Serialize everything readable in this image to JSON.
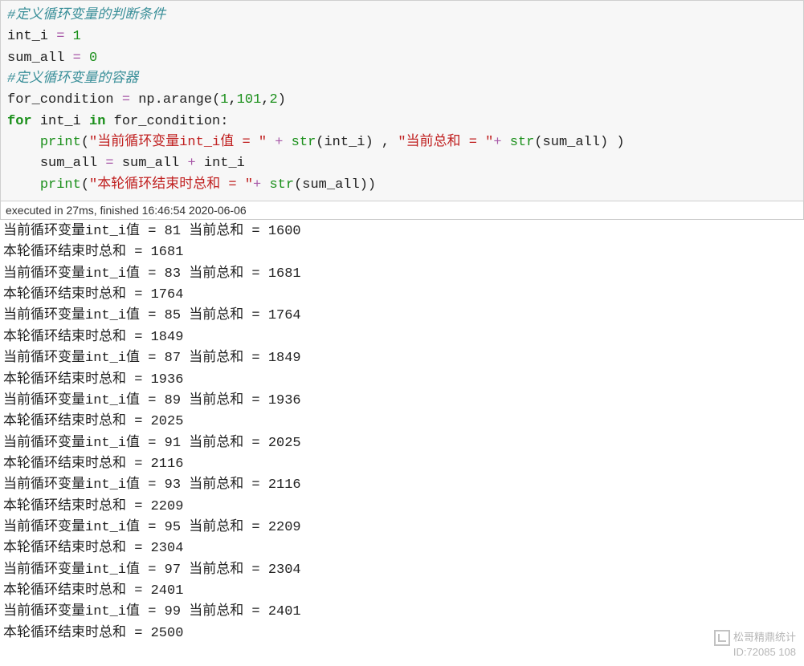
{
  "code": {
    "comment1": "#定义循环变量的判断条件",
    "line2_var": "int_i",
    "line2_eq": " = ",
    "line2_val": "1",
    "line3_var": "sum_all",
    "line3_eq": " = ",
    "line3_val": "0",
    "comment2": "#定义循环变量的容器",
    "line5_var": "for_condition",
    "line5_eq": " = ",
    "line5_np": "np.",
    "line5_fn": "arange",
    "line5_args_open": "(",
    "line5_arg1": "1",
    "line5_comma1": ",",
    "line5_arg2": "101",
    "line5_comma2": ",",
    "line5_arg3": "2",
    "line5_args_close": ")",
    "line6_for": "for",
    "line6_sp1": " ",
    "line6_var": "int_i",
    "line6_sp2": " ",
    "line6_in": "in",
    "line6_sp3": " ",
    "line6_iter": "for_condition",
    "line6_colon": ":",
    "indent": "    ",
    "line7_print": "print",
    "line7_open": "(",
    "line7_str1": "\"当前循环变量int_i值 = \"",
    "line7_plus1": " + ",
    "line7_str_fn1": "str",
    "line7_str_open1": "(",
    "line7_arg1": "int_i",
    "line7_str_close1": ")",
    "line7_comma": " , ",
    "line7_str2": "\"当前总和 = \"",
    "line7_plus2": "+ ",
    "line7_str_fn2": "str",
    "line7_str_open2": "(",
    "line7_arg2": "sum_all",
    "line7_str_close2": ")",
    "line7_close": " )",
    "line8_lhs": "sum_all",
    "line8_eq": " = ",
    "line8_rhs1": "sum_all",
    "line8_plus": " + ",
    "line8_rhs2": "int_i",
    "line9_print": "print",
    "line9_open": "(",
    "line9_str": "\"本轮循环结束时总和 = \"",
    "line9_plus": "+ ",
    "line9_str_fn": "str",
    "line9_str_open": "(",
    "line9_arg": "sum_all",
    "line9_str_close": ")",
    "line9_close": ")"
  },
  "exec_bar": "executed in 27ms, finished 16:46:54 2020-06-06",
  "output_lines": [
    "当前循环变量int_i值 = 81 当前总和 = 1600",
    "本轮循环结束时总和 = 1681",
    "当前循环变量int_i值 = 83 当前总和 = 1681",
    "本轮循环结束时总和 = 1764",
    "当前循环变量int_i值 = 85 当前总和 = 1764",
    "本轮循环结束时总和 = 1849",
    "当前循环变量int_i值 = 87 当前总和 = 1849",
    "本轮循环结束时总和 = 1936",
    "当前循环变量int_i值 = 89 当前总和 = 1936",
    "本轮循环结束时总和 = 2025",
    "当前循环变量int_i值 = 91 当前总和 = 2025",
    "本轮循环结束时总和 = 2116",
    "当前循环变量int_i值 = 93 当前总和 = 2116",
    "本轮循环结束时总和 = 2209",
    "当前循环变量int_i值 = 95 当前总和 = 2209",
    "本轮循环结束时总和 = 2304",
    "当前循环变量int_i值 = 97 当前总和 = 2304",
    "本轮循环结束时总和 = 2401",
    "当前循环变量int_i值 = 99 当前总和 = 2401",
    "本轮循环结束时总和 = 2500"
  ],
  "watermark": {
    "line1": "松哥精鼎统计",
    "line2": "ID:72085 108"
  }
}
